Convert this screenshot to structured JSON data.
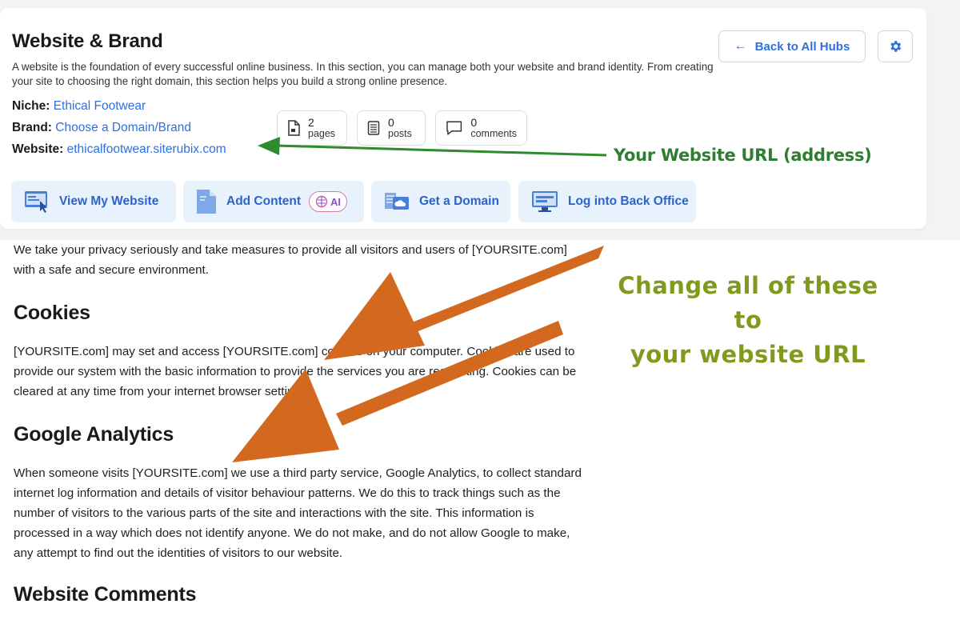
{
  "header": {
    "title": "Website & Brand",
    "description": "A website is the foundation of every successful online business. In this section, you can manage both your website and brand identity. From creating your site to choosing the right domain, this section helps you build a strong online presence.",
    "back_label": "Back to All Hubs"
  },
  "info": {
    "niche_label": "Niche:",
    "niche_value": "Ethical Footwear",
    "brand_label": "Brand:",
    "brand_value": "Choose a Domain/Brand",
    "website_label": "Website:",
    "website_value": "ethicalfootwear.siterubix.com"
  },
  "stats": {
    "pages_count": "2",
    "pages_label": "pages",
    "posts_count": "0",
    "posts_label": "posts",
    "comments_count": "0",
    "comments_label": "comments"
  },
  "actions": {
    "view": "View My Website",
    "add": "Add Content",
    "ai": "AI",
    "domain": "Get a Domain",
    "office": "Log into Back Office"
  },
  "annotations": {
    "url_callout": "Your Website URL (address)",
    "change_line1": "Change all of these to",
    "change_line2": "your website URL",
    "green_color": "#2e7d32",
    "orange_color": "#d2691e",
    "olive_color": "#7f9a1c"
  },
  "document": {
    "intro": "We take your privacy seriously and take measures to provide all visitors and users of [YOURSITE.com] with a safe and secure environment.",
    "cookies_heading": "Cookies",
    "cookies_text": "[YOURSITE.com] may set and access [YOURSITE.com] cookies on your computer. Cookies are used to provide our system with the basic information to provide the services you are requesting. Cookies can be cleared at any time from your internet browser settings.",
    "ga_heading": "Google Analytics",
    "ga_text": "When someone visits [YOURSITE.com] we use a third party service, Google Analytics, to collect standard internet log information and details of visitor behaviour patterns. We do this to track things such as the number of visitors to the various parts of the site and interactions with the site. This information is processed in a way which does not identify anyone. We do not make, and do not allow Google to make, any attempt to find out the identities of visitors to our website.",
    "comments_heading": "Website Comments"
  },
  "colors": {
    "link": "#2f6fde",
    "action_bg": "#e8f2fd"
  }
}
